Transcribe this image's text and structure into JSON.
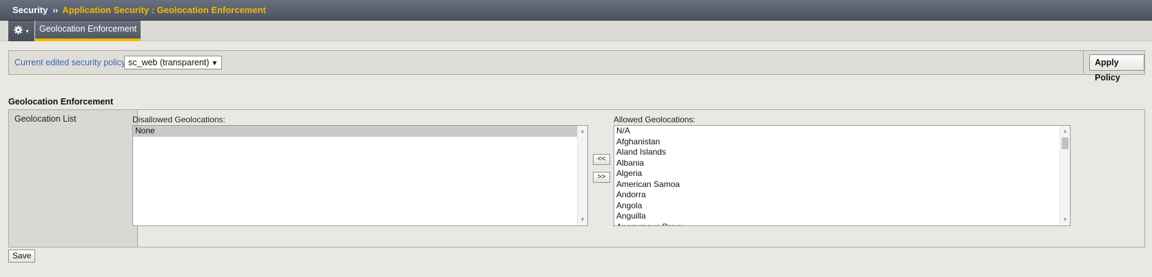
{
  "breadcrumb": {
    "root": "Security",
    "separator": "››",
    "current": "Application Security : Geolocation Enforcement"
  },
  "tabbar": {
    "gear_icon": "gear-icon",
    "gear_caret": "▾",
    "active_tab": "Geolocation Enforcement"
  },
  "policy": {
    "label": "Current edited security policy",
    "selected_value": "sc_web (transparent)",
    "select_arrow": "▼",
    "apply_label": "Apply Policy"
  },
  "section": {
    "title": "Geolocation Enforcement",
    "row_label": "Geolocation List",
    "disallowed": {
      "caption": "Disallowed Geolocations:",
      "items": [
        "None"
      ],
      "selected_index": 0
    },
    "allowed": {
      "caption": "Allowed Geolocations:",
      "items": [
        "N/A",
        "Afghanistan",
        "Aland Islands",
        "Albania",
        "Algeria",
        "American Samoa",
        "Andorra",
        "Angola",
        "Anguilla",
        "Anonymous Proxy"
      ]
    },
    "move_left_label": "<<",
    "move_right_label": ">>"
  },
  "save_label": "Save",
  "colors": {
    "accent": "#f5b800",
    "header_bg": "#5a6270",
    "link_blue": "#3a66b0",
    "page_bg": "#e9e8e3"
  }
}
